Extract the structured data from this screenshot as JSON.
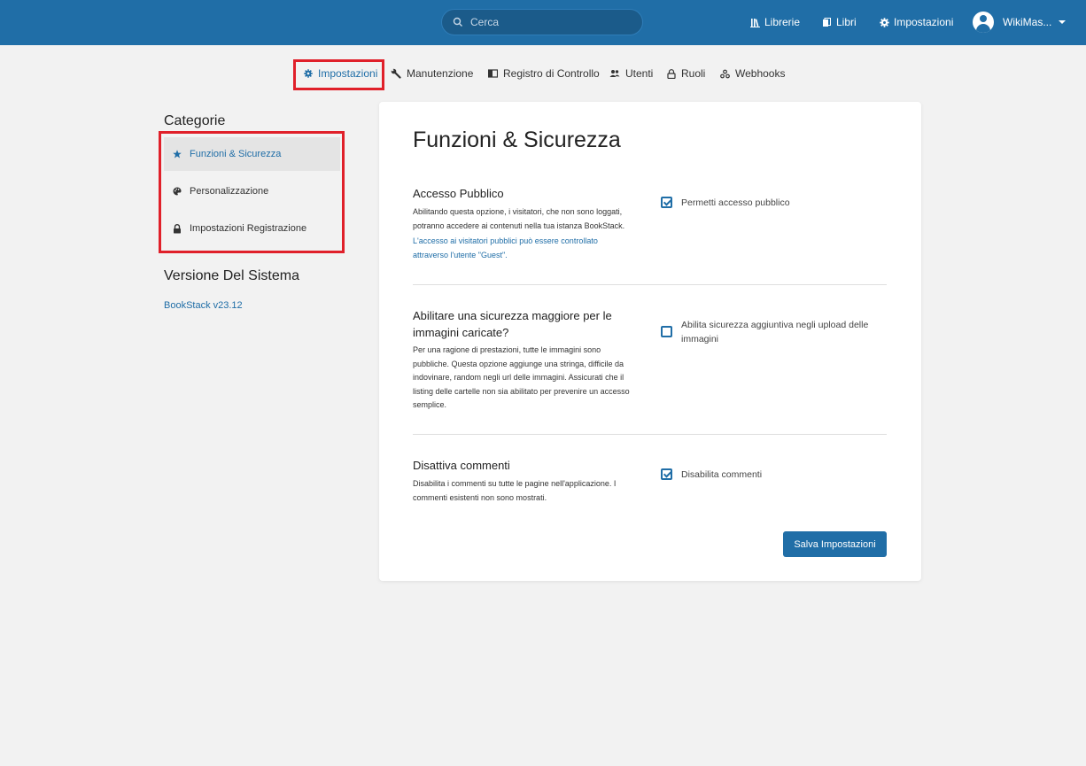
{
  "header": {
    "search_placeholder": "Cerca",
    "nav": [
      {
        "label": "Librerie",
        "icon": "bookshelf-icon"
      },
      {
        "label": "Libri",
        "icon": "books-icon"
      },
      {
        "label": "Impostazioni",
        "icon": "gear-icon"
      }
    ],
    "user_name": "WikiMas...",
    "colors": {
      "bar": "#206ea7",
      "accent": "#206ea7",
      "highlight": "#e0202a"
    }
  },
  "settings_nav": [
    {
      "label": "Impostazioni",
      "icon": "gear-icon",
      "active": true
    },
    {
      "label": "Manutenzione",
      "icon": "wrench-icon",
      "active": false
    },
    {
      "label": "Registro di Controllo",
      "icon": "audit-log-icon",
      "active": false
    },
    {
      "label": "Utenti",
      "icon": "users-icon",
      "active": false
    },
    {
      "label": "Ruoli",
      "icon": "lock-icon",
      "active": false
    },
    {
      "label": "Webhooks",
      "icon": "webhooks-icon",
      "active": false
    }
  ],
  "sidebar": {
    "categories_title": "Categorie",
    "items": [
      {
        "label": "Funzioni & Sicurezza",
        "icon": "star-icon",
        "active": true
      },
      {
        "label": "Personalizzazione",
        "icon": "palette-icon",
        "active": false
      },
      {
        "label": "Impostazioni Registrazione",
        "icon": "lock-icon",
        "active": false
      }
    ],
    "system_title": "Versione Del Sistema",
    "version_link": "BookStack v23.12"
  },
  "main": {
    "title": "Funzioni & Sicurezza",
    "sections": [
      {
        "title": "Accesso Pubblico",
        "description": "Abilitando questa opzione, i visitatori, che non sono loggati, potranno accedere ai contenuti nella tua istanza BookStack.",
        "link": "L'accesso ai visitatori pubblici può essere controllato attraverso l'utente \"Guest\".",
        "checkbox_label": "Permetti accesso pubblico",
        "checked": true
      },
      {
        "title": "Abilitare una sicurezza maggiore per le immagini caricate?",
        "description": "Per una ragione di prestazioni, tutte le immagini sono pubbliche. Questa opzione aggiunge una stringa, difficile da indovinare, random negli url delle immagini. Assicurati che il listing delle cartelle non sia abilitato per prevenire un accesso semplice.",
        "checkbox_label": "Abilita sicurezza aggiuntiva negli upload delle immagini",
        "checked": false
      },
      {
        "title": "Disattiva commenti",
        "description": "Disabilita i commenti su tutte le pagine nell'applicazione. I commenti esistenti non sono mostrati.",
        "checkbox_label": "Disabilita commenti",
        "checked": true
      }
    ],
    "save_label": "Salva Impostazioni"
  }
}
